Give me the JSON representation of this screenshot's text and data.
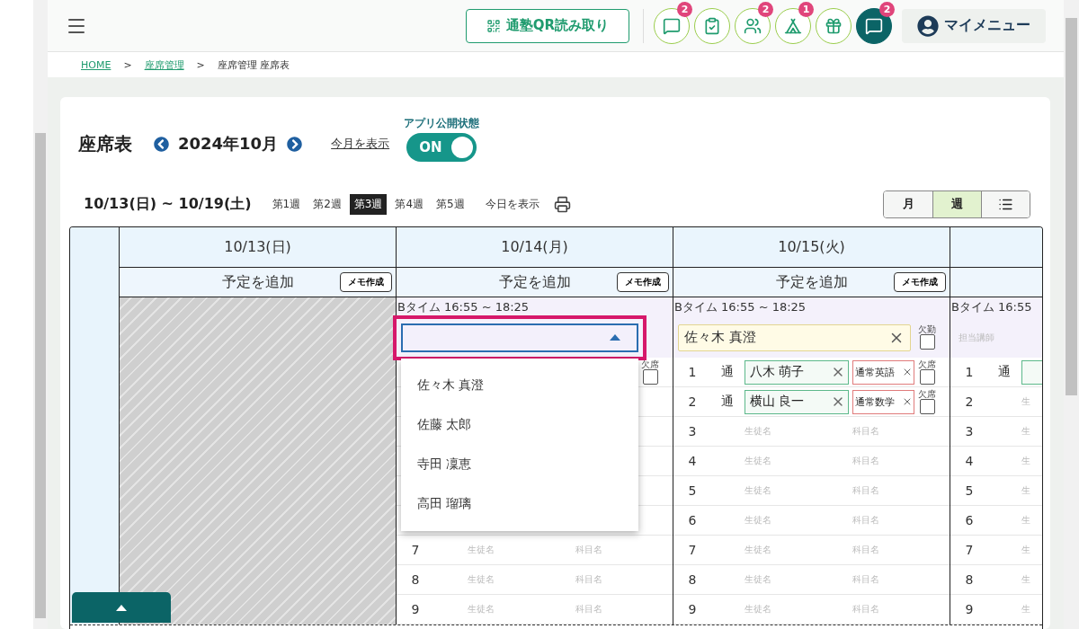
{
  "header": {
    "qr_button": "通塾QR読み取り",
    "icons": [
      {
        "kind": "chat",
        "badge": "2",
        "selected": false
      },
      {
        "kind": "checklist",
        "selected": false
      },
      {
        "kind": "group",
        "badge": "2",
        "selected": false
      },
      {
        "kind": "tent",
        "badge": "1",
        "selected": false
      },
      {
        "kind": "gift",
        "selected": false
      },
      {
        "kind": "chat",
        "badge": "2",
        "selected": true
      }
    ],
    "my_menu": "マイメニュー"
  },
  "breadcrumb": [
    {
      "label": "HOME",
      "link": true
    },
    {
      "label": ">",
      "link": false
    },
    {
      "label": "座席管理",
      "link": true
    },
    {
      "label": ">",
      "link": false
    },
    {
      "label": "座席管理 座席表",
      "link": false
    }
  ],
  "title": "座席表",
  "month": "2024年10月",
  "this_month_link": "今月を表示",
  "app_status": {
    "label": "アプリ公開状態",
    "text": "ON",
    "on": true
  },
  "range": "10/13(日) ~ 10/19(土)",
  "weeks": [
    {
      "label": "第1週",
      "selected": false
    },
    {
      "label": "第2週",
      "selected": false
    },
    {
      "label": "第3週",
      "selected": true
    },
    {
      "label": "第4週",
      "selected": false
    },
    {
      "label": "第5週",
      "selected": false
    }
  ],
  "today_link": "今日を表示",
  "views": [
    {
      "kind": "text",
      "label": "月",
      "selected": false
    },
    {
      "kind": "text",
      "label": "週",
      "selected": true
    },
    {
      "kind": "list",
      "selected": false
    }
  ],
  "days": [
    {
      "kind": "closed",
      "date": "10/13(日)",
      "add_label": "予定を追加",
      "memo_label": "メモ作成"
    },
    {
      "kind": "open",
      "date": "10/14(月)",
      "add_label": "予定を追加",
      "memo_label": "メモ作成",
      "time": "Bタイム 16:55 ~ 18:25",
      "teacher": {
        "kind": "dropdown",
        "open": true,
        "options": [
          "佐々木 真澄",
          "佐藤 太郎",
          "寺田 凜恵",
          "高田 瑠璃"
        ]
      },
      "rows": [
        {
          "kind": "covered",
          "absence": {
            "label": "欠席",
            "checked": false
          }
        },
        {
          "kind": "covered"
        },
        {
          "kind": "covered"
        },
        {
          "kind": "covered"
        },
        {
          "kind": "covered"
        },
        {
          "kind": "covered"
        },
        {
          "kind": "seat",
          "number": "7",
          "student": {
            "placeholder": "生徒名"
          },
          "subject": {
            "placeholder": "科目名"
          }
        },
        {
          "kind": "seat",
          "number": "8",
          "student": {
            "placeholder": "生徒名"
          },
          "subject": {
            "placeholder": "科目名"
          }
        },
        {
          "kind": "seat",
          "number": "9",
          "student": {
            "placeholder": "生徒名"
          },
          "subject": {
            "placeholder": "科目名"
          }
        }
      ]
    },
    {
      "kind": "open",
      "date": "10/15(火)",
      "add_label": "予定を追加",
      "memo_label": "メモ作成",
      "time": "Bタイム 16:55 ~ 18:25",
      "teacher": {
        "kind": "chip",
        "name": "佐々木 真澄",
        "absence": {
          "label": "欠勤",
          "checked": false
        }
      },
      "rows": [
        {
          "kind": "seat",
          "number": "1",
          "type": "通",
          "student": {
            "name": "八木 萌子"
          },
          "subject": {
            "name": "通常英語"
          },
          "absence": {
            "label": "欠席",
            "checked": false
          }
        },
        {
          "kind": "seat",
          "number": "2",
          "type": "通",
          "student": {
            "name": "横山 良一"
          },
          "subject": {
            "name": "通常数学"
          },
          "absence": {
            "label": "欠席",
            "checked": false
          }
        },
        {
          "kind": "seat",
          "number": "3",
          "student": {
            "placeholder": "生徒名"
          },
          "subject": {
            "placeholder": "科目名"
          }
        },
        {
          "kind": "seat",
          "number": "4",
          "student": {
            "placeholder": "生徒名"
          },
          "subject": {
            "placeholder": "科目名"
          }
        },
        {
          "kind": "seat",
          "number": "5",
          "student": {
            "placeholder": "生徒名"
          },
          "subject": {
            "placeholder": "科目名"
          }
        },
        {
          "kind": "seat",
          "number": "6",
          "student": {
            "placeholder": "生徒名"
          },
          "subject": {
            "placeholder": "科目名"
          }
        },
        {
          "kind": "seat",
          "number": "7",
          "student": {
            "placeholder": "生徒名"
          },
          "subject": {
            "placeholder": "科目名"
          }
        },
        {
          "kind": "seat",
          "number": "8",
          "student": {
            "placeholder": "生徒名"
          },
          "subject": {
            "placeholder": "科目名"
          }
        },
        {
          "kind": "seat",
          "number": "9",
          "student": {
            "placeholder": "生徒名"
          },
          "subject": {
            "placeholder": "科目名"
          }
        }
      ]
    },
    {
      "kind": "open",
      "time": "Bタイム 16:55",
      "teacher": {
        "kind": "placeholder",
        "placeholder": "担当講師"
      },
      "rows": [
        {
          "kind": "seat",
          "number": "1",
          "type": "通",
          "student": {
            "kind": "cut_chip"
          }
        },
        {
          "kind": "seat",
          "number": "2",
          "student": {
            "placeholder": "生"
          }
        },
        {
          "kind": "seat",
          "number": "3",
          "student": {
            "placeholder": "生"
          }
        },
        {
          "kind": "seat",
          "number": "4",
          "student": {
            "placeholder": "生"
          }
        },
        {
          "kind": "seat",
          "number": "5",
          "student": {
            "placeholder": "生"
          }
        },
        {
          "kind": "seat",
          "number": "6",
          "student": {
            "placeholder": "生"
          }
        },
        {
          "kind": "seat",
          "number": "7",
          "student": {
            "placeholder": "生"
          }
        },
        {
          "kind": "seat",
          "number": "8",
          "student": {
            "placeholder": "生"
          }
        },
        {
          "kind": "seat",
          "number": "9",
          "student": {
            "placeholder": "生"
          }
        }
      ]
    }
  ]
}
